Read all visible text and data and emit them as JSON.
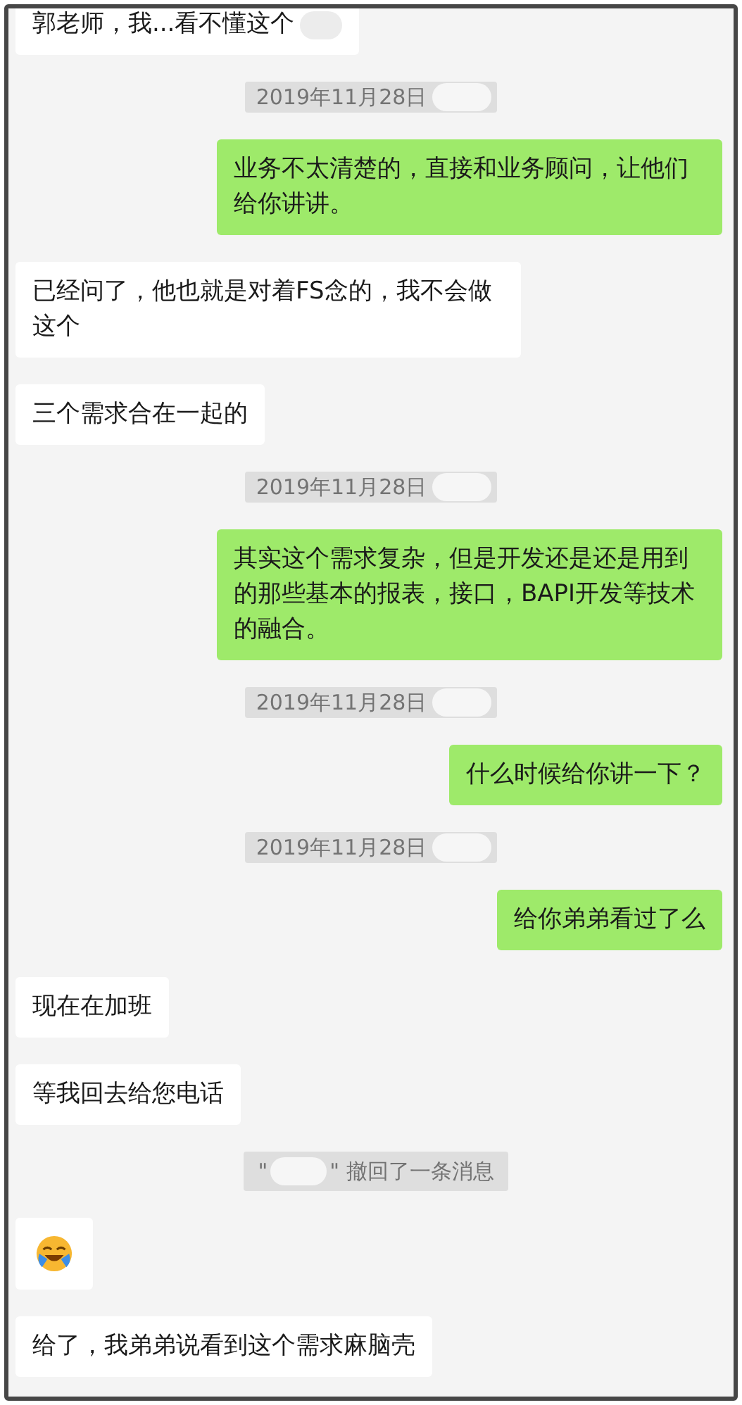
{
  "messages": [
    {
      "kind": "received",
      "text": "郭老师，我...看不懂这个",
      "redacted": true
    },
    {
      "kind": "time",
      "text": "2019年11月28日",
      "redacted": true
    },
    {
      "kind": "sent",
      "text": "业务不太清楚的，直接和业务顾问，让他们给你讲讲。"
    },
    {
      "kind": "received",
      "text": "已经问了，他也就是对着FS念的，我不会做这个"
    },
    {
      "kind": "received",
      "text": "三个需求合在一起的"
    },
    {
      "kind": "time",
      "text": "2019年11月28日",
      "redacted": true
    },
    {
      "kind": "sent",
      "text": "其实这个需求复杂，但是开发还是还是用到的那些基本的报表，接口，BAPI开发等技术的融合。"
    },
    {
      "kind": "time",
      "text": "2019年11月28日",
      "redacted": true
    },
    {
      "kind": "sent",
      "text": "什么时候给你讲一下？"
    },
    {
      "kind": "time",
      "text": "2019年11月28日",
      "redacted": true
    },
    {
      "kind": "sent",
      "text": "给你弟弟看过了么"
    },
    {
      "kind": "received",
      "text": "现在在加班"
    },
    {
      "kind": "received",
      "text": "等我回去给您电话"
    },
    {
      "kind": "recall",
      "prefix": "\"",
      "text": "\" 撤回了一条消息",
      "redacted": true
    },
    {
      "kind": "emoji"
    },
    {
      "kind": "received",
      "text": "给了，我弟弟说看到这个需求麻脑壳"
    }
  ]
}
